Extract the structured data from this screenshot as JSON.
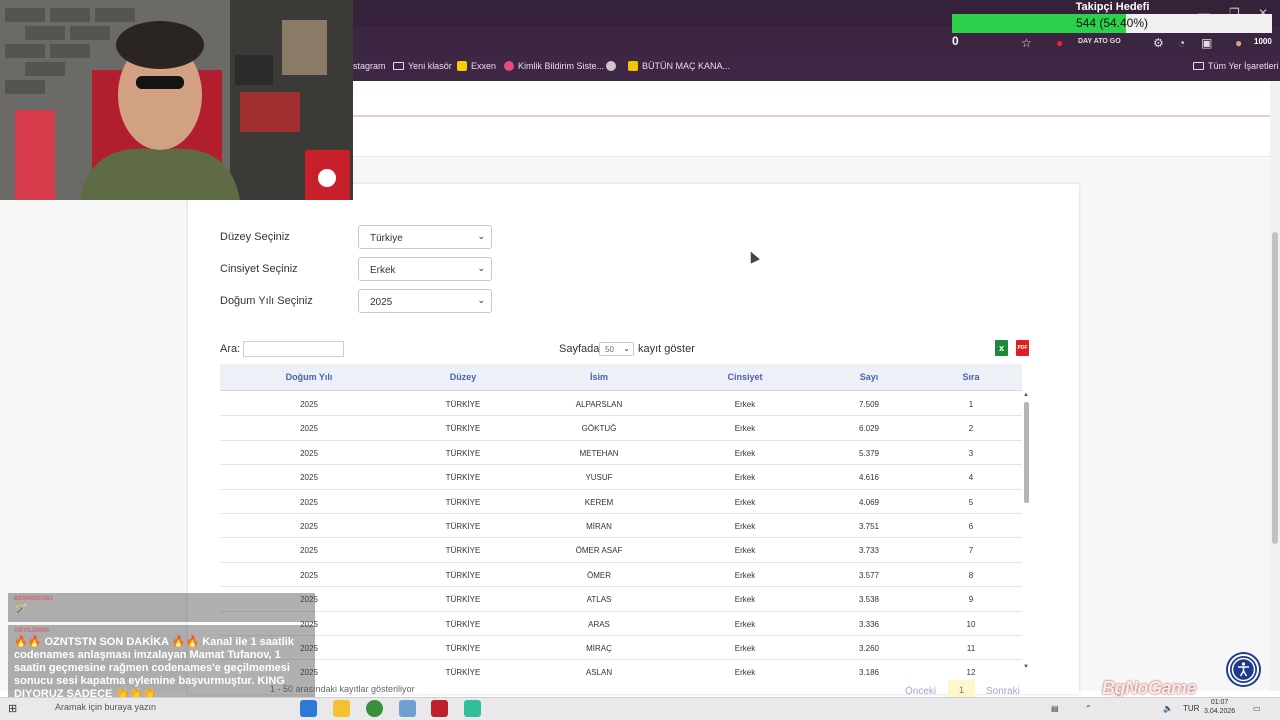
{
  "stream": {
    "follow_goal": {
      "title": "Takipçi Hedefi",
      "progress_text": "544 (54.40%)",
      "progress_percent": 54.4,
      "current_left": "0",
      "target_right": "1000",
      "fill_color": "#2bd14a"
    },
    "chat": [
      {
        "user": "BENIMBEN61",
        "message": "🪄"
      },
      {
        "user": "ABYILDIRIM",
        "message": "🔥🔥 OZNTSTN SON DAKİKA 🔥🔥 Kanal ile 1 saatlik codenames anlaşması imzalayan Mamat Tufanov, 1 saatin geçmesine rağmen codenames'e geçilmemesi sonucu sesi kapatma eylemine başvurmuştur. KING DIYORUZ SADECE 👏👏👏"
      }
    ],
    "brand_text": "BgNoGame",
    "webcam_text": "DAY ATO GO"
  },
  "browser": {
    "bookmarks": [
      "stagram",
      "Yeni klasör",
      "Exxen",
      "Kimlik Bildirim Siste...",
      "BÜTÜN MAÇ KANA...",
      "Tüm Yer İşaretleri"
    ],
    "accent_color": "#3b2540"
  },
  "filters": {
    "level": {
      "label": "Düzey Seçiniz",
      "value": "Türkiye"
    },
    "gender": {
      "label": "Cinsiyet Seçiniz",
      "value": "Erkek"
    },
    "year": {
      "label": "Doğum Yılı Seçiniz",
      "value": "2025"
    }
  },
  "table_controls": {
    "search_label": "Ara:",
    "per_page_before": "Sayfada",
    "per_page_value": "50",
    "per_page_after": "kayıt göster",
    "excel_icon_letter": "x",
    "pdf_icon_text": "PDF"
  },
  "table": {
    "columns": [
      "Doğum Yılı",
      "Düzey",
      "İsim",
      "Cinsiyet",
      "Sayı",
      "Sıra"
    ],
    "rows": [
      [
        "2025",
        "TÜRKİYE",
        "ALPARSLAN",
        "Erkek",
        "7.509",
        "1"
      ],
      [
        "2025",
        "TÜRKİYE",
        "GÖKTUĞ",
        "Erkek",
        "6.029",
        "2"
      ],
      [
        "2025",
        "TÜRKİYE",
        "METEHAN",
        "Erkek",
        "5.379",
        "3"
      ],
      [
        "2025",
        "TÜRKİYE",
        "YUSUF",
        "Erkek",
        "4.616",
        "4"
      ],
      [
        "2025",
        "TÜRKİYE",
        "KEREM",
        "Erkek",
        "4.069",
        "5"
      ],
      [
        "2025",
        "TÜRKİYE",
        "MİRAN",
        "Erkek",
        "3.751",
        "6"
      ],
      [
        "2025",
        "TÜRKİYE",
        "ÖMER ASAF",
        "Erkek",
        "3.733",
        "7"
      ],
      [
        "2025",
        "TÜRKİYE",
        "ÖMER",
        "Erkek",
        "3.577",
        "8"
      ],
      [
        "2025",
        "TÜRKİYE",
        "ATLAS",
        "Erkek",
        "3.538",
        "9"
      ],
      [
        "2025",
        "TÜRKİYE",
        "ARAS",
        "Erkek",
        "3.336",
        "10"
      ],
      [
        "2025",
        "TÜRKİYE",
        "MİRAÇ",
        "Erkek",
        "3.260",
        "11"
      ],
      [
        "2025",
        "TÜRKİYE",
        "ASLAN",
        "Erkek",
        "3.186",
        "12"
      ]
    ]
  },
  "pagination": {
    "info": "1 - 50 arasındaki kayıtlar gösteriliyor",
    "prev": "Önceki",
    "current": "1",
    "next": "Sonraki"
  },
  "taskbar": {
    "search_placeholder": "Aramak için buraya yazın",
    "language": "TUR",
    "time": "01:07",
    "date": "3.04.2026"
  }
}
